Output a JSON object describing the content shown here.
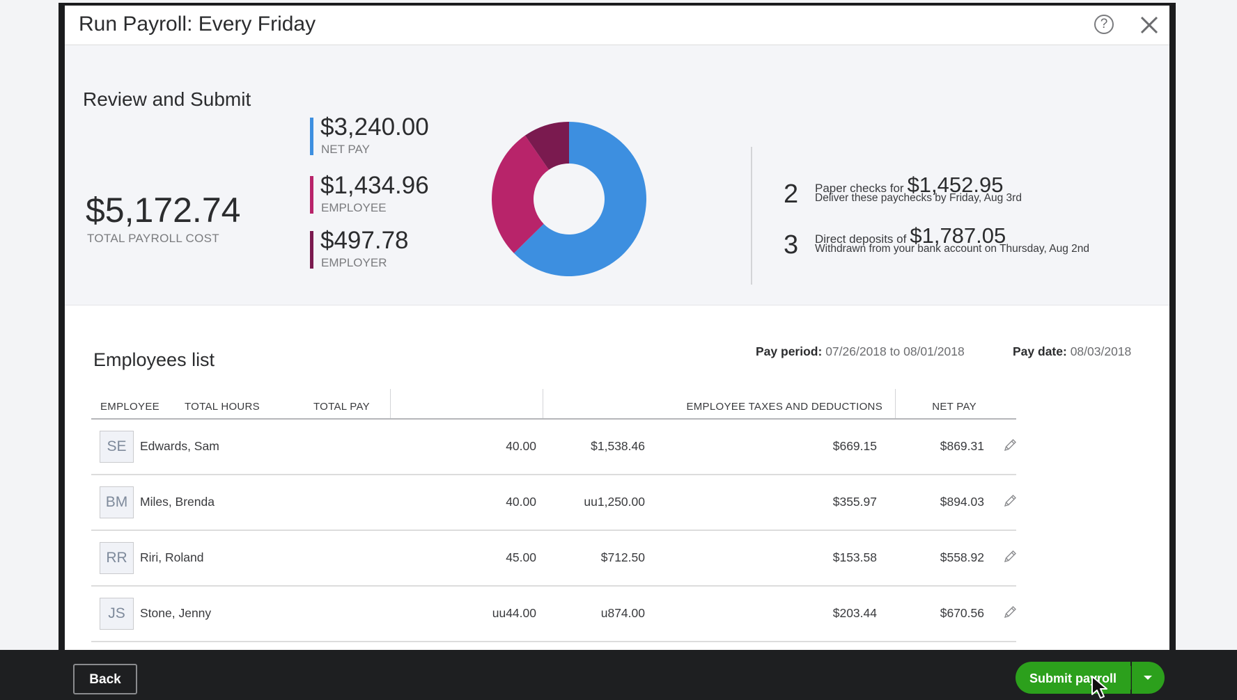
{
  "window": {
    "title": "Run Payroll: Every Friday",
    "help_glyph": "?"
  },
  "summary": {
    "heading": "Review and Submit",
    "total": {
      "amount": "$5,172.74",
      "label": "TOTAL PAYROLL COST"
    },
    "breakdown": [
      {
        "amount": "$3,240.00",
        "label": "NET PAY",
        "color": "#3d8fe0"
      },
      {
        "amount": "$1,434.96",
        "label": "EMPLOYEE",
        "color": "#b8246a"
      },
      {
        "amount": "$497.78",
        "label": "EMPLOYER",
        "color": "#7a1a4f"
      }
    ],
    "donut": {
      "slices": [
        {
          "name": "NET PAY",
          "value": 3240.0,
          "color": "#3d8fe0"
        },
        {
          "name": "EMPLOYEE",
          "value": 1434.96,
          "color": "#b8246a"
        },
        {
          "name": "EMPLOYER",
          "value": 497.78,
          "color": "#7a1a4f"
        }
      ]
    },
    "paper_checks": {
      "count": "2",
      "text": "Paper checks for",
      "amount": "$1,452.95",
      "sub": "Deliver these paychecks by Friday, Aug 3rd"
    },
    "direct_deposits": {
      "count": "3",
      "text": "Direct deposits of",
      "amount": "$1,787.05",
      "sub": "Withdrawn from your bank account on Thursday, Aug 2nd"
    }
  },
  "employees_list": {
    "title": "Employees list",
    "pay_period_label": "Pay period:",
    "pay_period_value": "07/26/2018 to 08/01/2018",
    "pay_date_label": "Pay date:",
    "pay_date_value": "08/03/2018",
    "columns": [
      "EMPLOYEE",
      "TOTAL HOURS",
      "TOTAL PAY",
      "EMPLOYEE TAXES AND DEDUCTIONS",
      "NET PAY"
    ],
    "rows": [
      {
        "initials": "SE",
        "name": "Edwards, Sam",
        "hours": "40.00",
        "total_pay": "$1,538.46",
        "taxes": "$669.15",
        "net_pay": "$869.31"
      },
      {
        "initials": "BM",
        "name": "Miles, Brenda",
        "hours": "40.00",
        "total_pay": "uu1,250.00",
        "taxes": "$355.97",
        "net_pay": "$894.03"
      },
      {
        "initials": "RR",
        "name": "Riri, Roland",
        "hours": "45.00",
        "total_pay": "$712.50",
        "taxes": "$153.58",
        "net_pay": "$558.92"
      },
      {
        "initials": "JS",
        "name": "Stone, Jenny",
        "hours": "uu44.00",
        "total_pay": "u874.00",
        "taxes": "$203.44",
        "net_pay": "$670.56"
      }
    ]
  },
  "footer": {
    "back_label": "Back",
    "submit_label": "Submit payroll"
  },
  "icons": {
    "help": "help-circle-icon",
    "close": "close-icon",
    "edit": "pencil-icon",
    "dropdown": "caret-down-icon",
    "cursor": "mouse-pointer-icon"
  }
}
